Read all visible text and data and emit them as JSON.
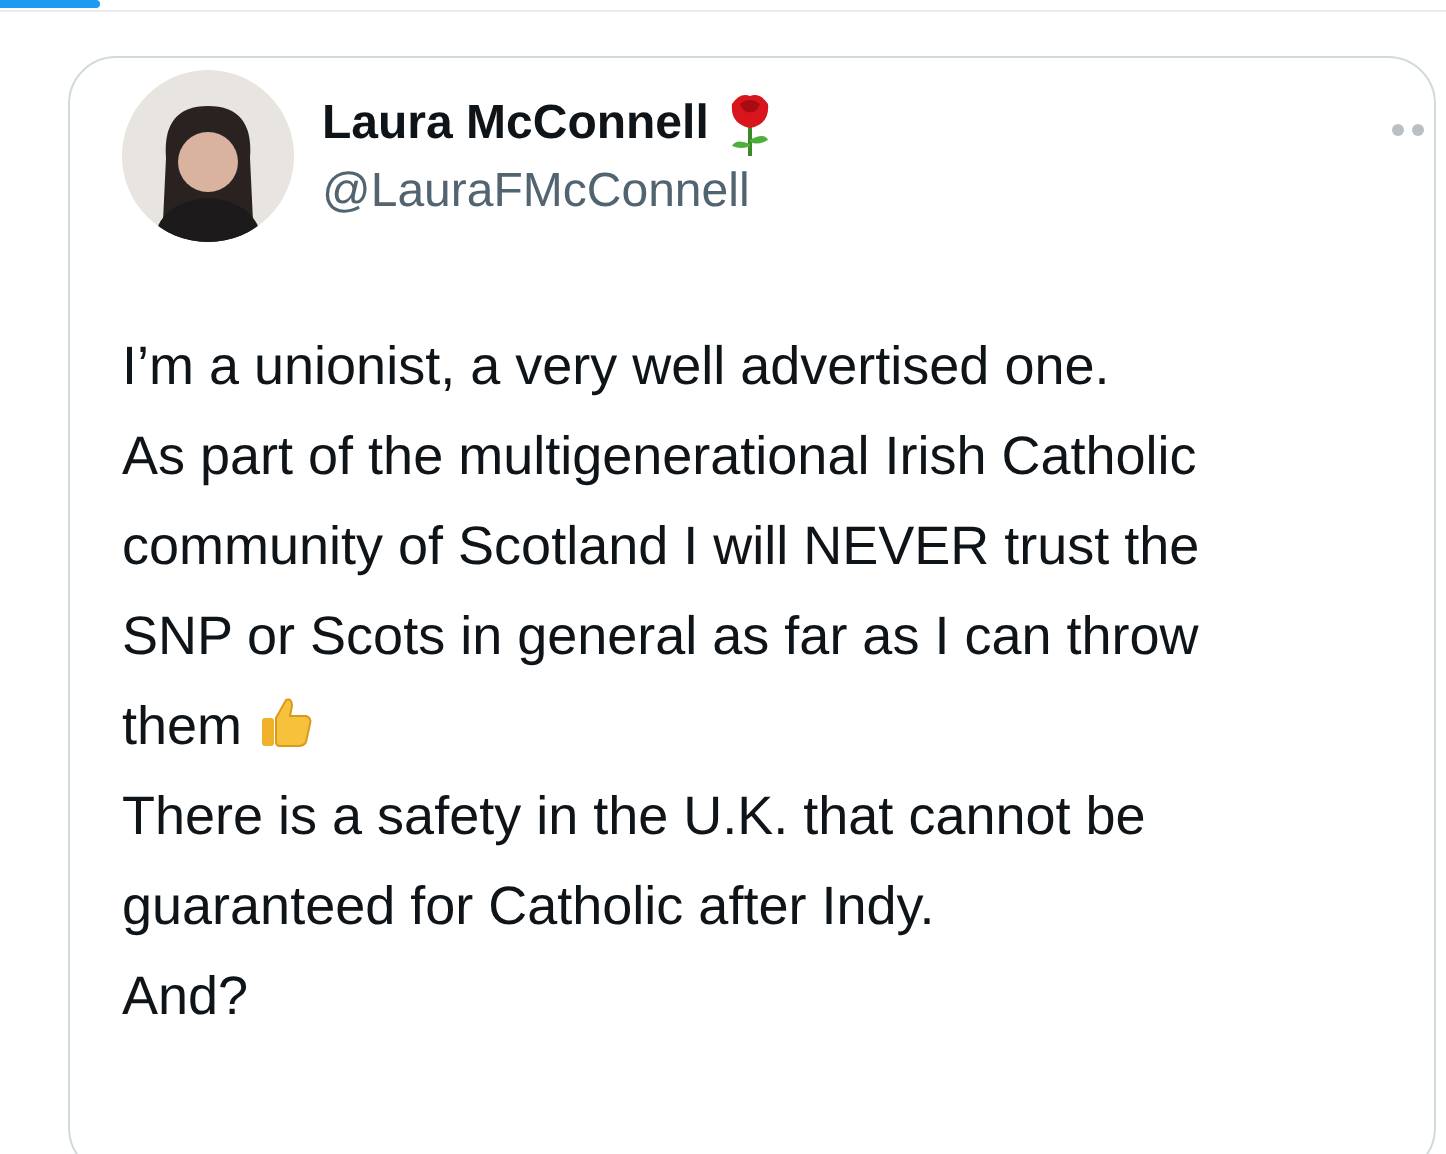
{
  "tweet": {
    "author": {
      "name": "Laura McConnell",
      "handle": "@LauraFMcConnell"
    },
    "paragraphs": [
      {
        "text": "I’m a unionist, a very well advertised one.",
        "thumbs_up": false
      },
      {
        "text": "As part of the multigenerational Irish Catholic\ncommunity of Scotland I will NEVER trust the\nSNP or Scots in general as far as I can throw\nthem",
        "thumbs_up": true
      },
      {
        "text": "There is a safety in the U.K. that cannot be\nguaranteed for Catholic after Indy.",
        "thumbs_up": false
      },
      {
        "text": "And?",
        "thumbs_up": false
      }
    ]
  }
}
